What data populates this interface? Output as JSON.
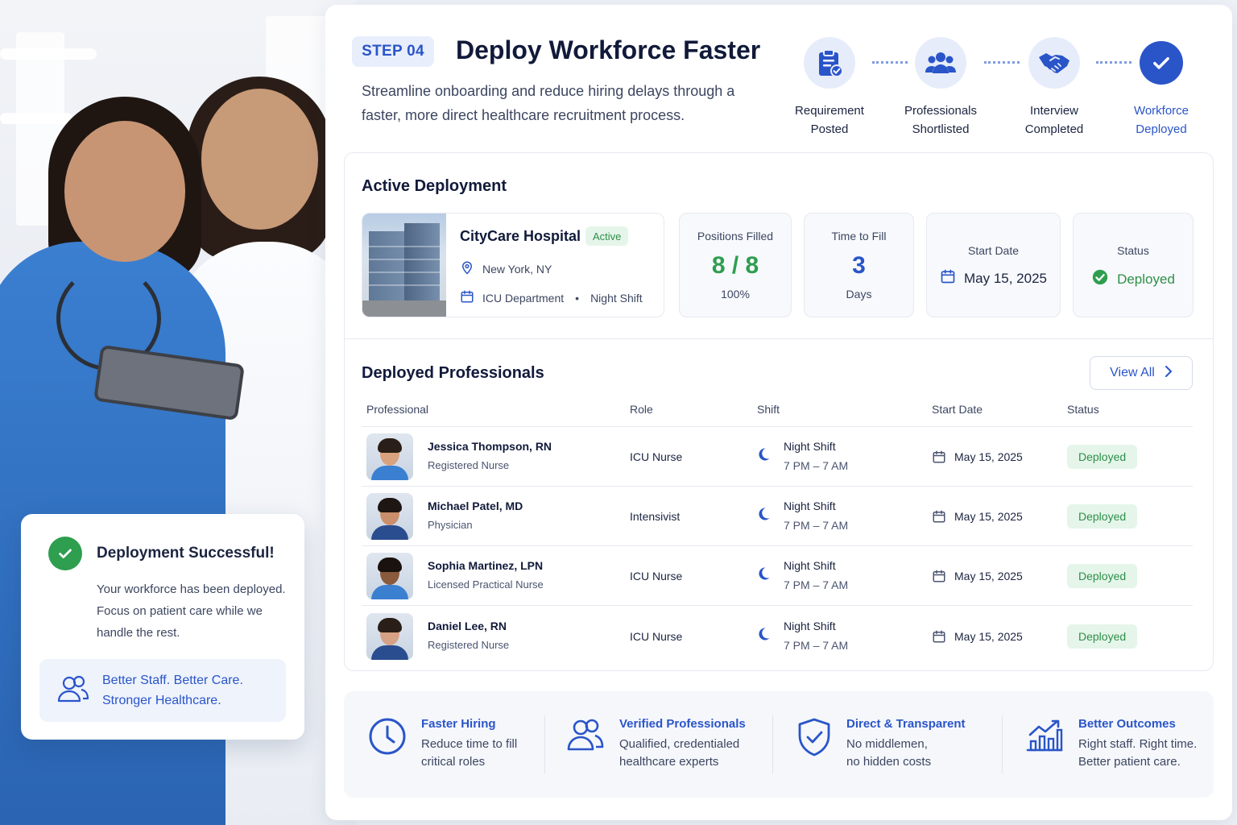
{
  "step_badge": "STEP 04",
  "title": "Deploy Workforce Faster",
  "subtitle": "Streamline onboarding and reduce hiring delays through a faster, more direct healthcare recruitment process.",
  "stepper": [
    {
      "line1": "Requirement",
      "line2": "Posted",
      "icon": "clipboard-check-icon"
    },
    {
      "line1": "Professionals",
      "line2": "Shortlisted",
      "icon": "users-group-icon"
    },
    {
      "line1": "Interview",
      "line2": "Completed",
      "icon": "handshake-icon"
    },
    {
      "line1": "Workforce",
      "line2": "Deployed",
      "icon": "check-icon"
    }
  ],
  "active_deployment": {
    "title": "Active Deployment",
    "hospital": {
      "name": "CityCare Hospital",
      "badge": "Active",
      "location": "New York, NY",
      "department": "ICU Department",
      "shift": "Night Shift"
    },
    "positions": {
      "label": "Positions Filled",
      "value": "8 / 8",
      "percent": "100%"
    },
    "time_to_fill": {
      "label": "Time to Fill",
      "value": "3",
      "unit": "Days"
    },
    "start_date": {
      "label": "Start Date",
      "value": "May 15, 2025"
    },
    "status": {
      "label": "Status",
      "value": "Deployed"
    }
  },
  "professionals": {
    "title": "Deployed Professionals",
    "view_all": "View All",
    "columns": [
      "Professional",
      "Role",
      "Shift",
      "Start Date",
      "Status"
    ],
    "rows": [
      {
        "name": "Jessica Thompson, RN",
        "title": "Registered Nurse",
        "role": "ICU Nurse",
        "shift": "Night Shift",
        "hours": "7 PM – 7 AM",
        "date": "May 15, 2025",
        "status": "Deployed"
      },
      {
        "name": "Michael Patel, MD",
        "title": "Physician",
        "role": "Intensivist",
        "shift": "Night Shift",
        "hours": "7 PM – 7 AM",
        "date": "May 15, 2025",
        "status": "Deployed"
      },
      {
        "name": "Sophia Martinez, LPN",
        "title": "Licensed Practical Nurse",
        "role": "ICU Nurse",
        "shift": "Night Shift",
        "hours": "7 PM – 7 AM",
        "date": "May 15, 2025",
        "status": "Deployed"
      },
      {
        "name": "Daniel Lee, RN",
        "title": "Registered Nurse",
        "role": "ICU Nurse",
        "shift": "Night Shift",
        "hours": "7 PM – 7 AM",
        "date": "May 15, 2025",
        "status": "Deployed"
      }
    ]
  },
  "features": [
    {
      "title": "Faster Hiring",
      "line1": "Reduce time to fill",
      "line2": "critical roles",
      "icon": "clock-icon"
    },
    {
      "title": "Verified Professionals",
      "line1": "Qualified, credentialed",
      "line2": "healthcare experts",
      "icon": "users-icon"
    },
    {
      "title": "Direct & Transparent",
      "line1": "No middlemen,",
      "line2": "no hidden costs",
      "icon": "shield-check-icon"
    },
    {
      "title": "Better Outcomes",
      "line1": "Right staff. Right time.",
      "line2": "Better patient care.",
      "icon": "chart-growth-icon"
    }
  ],
  "success_card": {
    "title": "Deployment Successful!",
    "text": "Your workforce has been deployed. Focus on patient care while we handle the rest.",
    "band_line1": "Better Staff. Better Care.",
    "band_line2": "Stronger Healthcare."
  },
  "colors": {
    "accent": "#2a55c9",
    "success": "#2e9e4f",
    "title": "#111a3a"
  }
}
